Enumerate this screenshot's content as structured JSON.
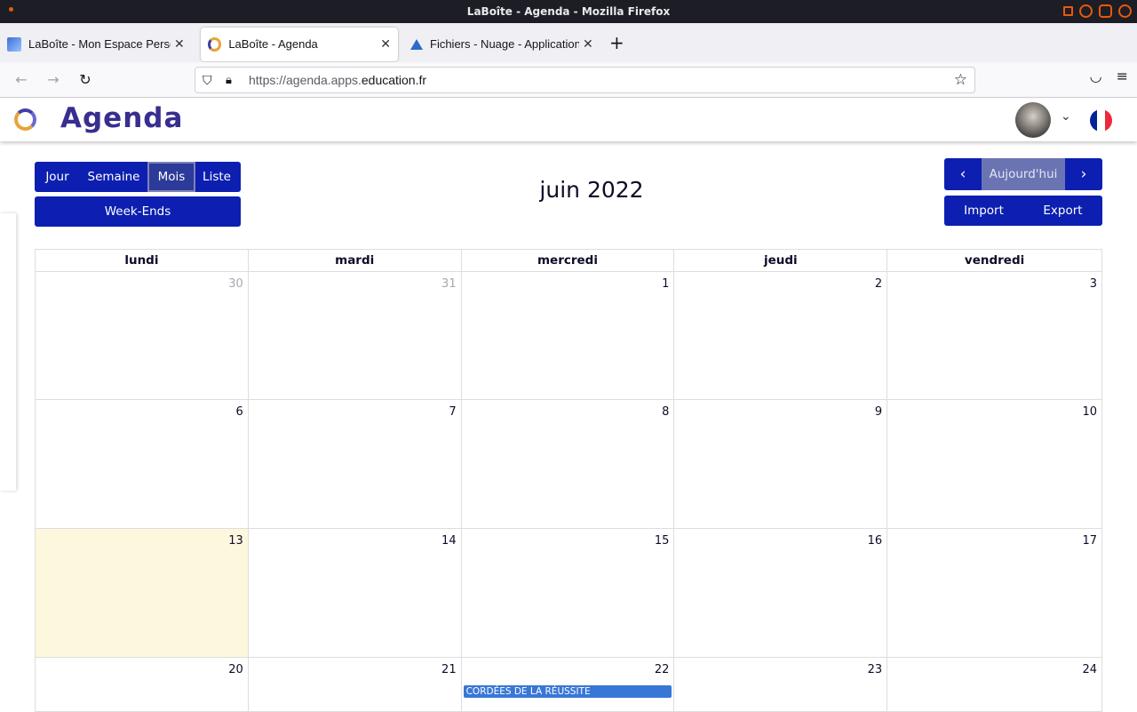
{
  "window": {
    "title": "LaBoîte - Agenda - Mozilla Firefox"
  },
  "tabs": [
    {
      "label": "LaBoîte - Mon Espace Perso",
      "icon": "laboite-icon",
      "active": false
    },
    {
      "label": "LaBoîte - Agenda",
      "icon": "agenda-icon",
      "active": true
    },
    {
      "label": "Fichiers - Nuage - Application",
      "icon": "nuage-icon",
      "active": false
    }
  ],
  "browser": {
    "url_prefix": "https://agenda.apps.",
    "url_domain": "education.fr"
  },
  "app": {
    "name": "Agenda",
    "views": {
      "day": "Jour",
      "week": "Semaine",
      "month": "Mois",
      "list": "Liste"
    },
    "active_view": "Mois",
    "weekends": "Week-Ends",
    "title": "juin 2022",
    "today": "Aujourd'hui",
    "import": "Import",
    "export": "Export",
    "flag_colors": [
      "#002395",
      "#ffffff",
      "#ed2939"
    ]
  },
  "calendar": {
    "weekdays": [
      "lundi",
      "mardi",
      "mercredi",
      "jeudi",
      "vendredi"
    ],
    "weeks": [
      [
        "30",
        "31",
        "1",
        "2",
        "3"
      ],
      [
        "6",
        "7",
        "8",
        "9",
        "10"
      ],
      [
        "13",
        "14",
        "15",
        "16",
        "17"
      ],
      [
        "20",
        "21",
        "22",
        "23",
        "24"
      ]
    ],
    "other_month_days": [
      "30",
      "31"
    ],
    "today": "13",
    "events": [
      {
        "day": "22",
        "title": "CORDÉES DE LA RÉUSSITE",
        "color": "#3877d6"
      }
    ]
  }
}
